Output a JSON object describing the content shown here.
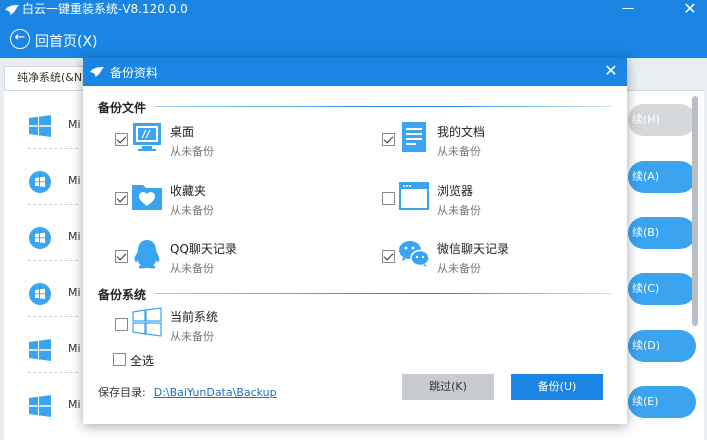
{
  "window": {
    "title": "白云一键重装系统-V8.120.0.0",
    "minimize_glyph": "—",
    "close_glyph": "✕"
  },
  "nav": {
    "back_label": "回首页(X)",
    "back_glyph": "←"
  },
  "background": {
    "tab_label": "纯净系统(&N",
    "rows": [
      {
        "label": "Mi",
        "button": "续(H)"
      },
      {
        "label": "Mi",
        "button": "续(A)"
      },
      {
        "label": "Mi",
        "button": "续(B)"
      },
      {
        "label": "Mi",
        "button": "续(C)"
      },
      {
        "label": "Mi",
        "button": "续(D)"
      },
      {
        "label": "Mi",
        "button": "续(E)"
      }
    ]
  },
  "dialog": {
    "title": "备份资料",
    "close_glyph": "✕",
    "section_files": "备份文件",
    "section_system": "备份系统",
    "items": [
      {
        "name": "桌面",
        "status": "从未备份",
        "icon": "desktop-icon",
        "checked": true
      },
      {
        "name": "我的文档",
        "status": "从未备份",
        "icon": "documents-icon",
        "checked": true
      },
      {
        "name": "收藏夹",
        "status": "从未备份",
        "icon": "favorites-icon",
        "checked": true
      },
      {
        "name": "浏览器",
        "status": "从未备份",
        "icon": "browser-icon",
        "checked": false
      },
      {
        "name": "QQ聊天记录",
        "status": "从未备份",
        "icon": "qq-icon",
        "checked": true
      },
      {
        "name": "微信聊天记录",
        "status": "从未备份",
        "icon": "wechat-icon",
        "checked": true
      }
    ],
    "system_item": {
      "name": "当前系统",
      "status": "从未备份",
      "icon": "windows-icon",
      "checked": false
    },
    "select_all": "全选",
    "save_dir_label": "保存目录:",
    "save_dir_path": "D:\\BaiYunData\\Backup",
    "skip_button": "跳过(K)",
    "backup_button": "备份(U)"
  },
  "colors": {
    "accent": "#1a85e3",
    "icon_blue": "#3aa4f0"
  }
}
